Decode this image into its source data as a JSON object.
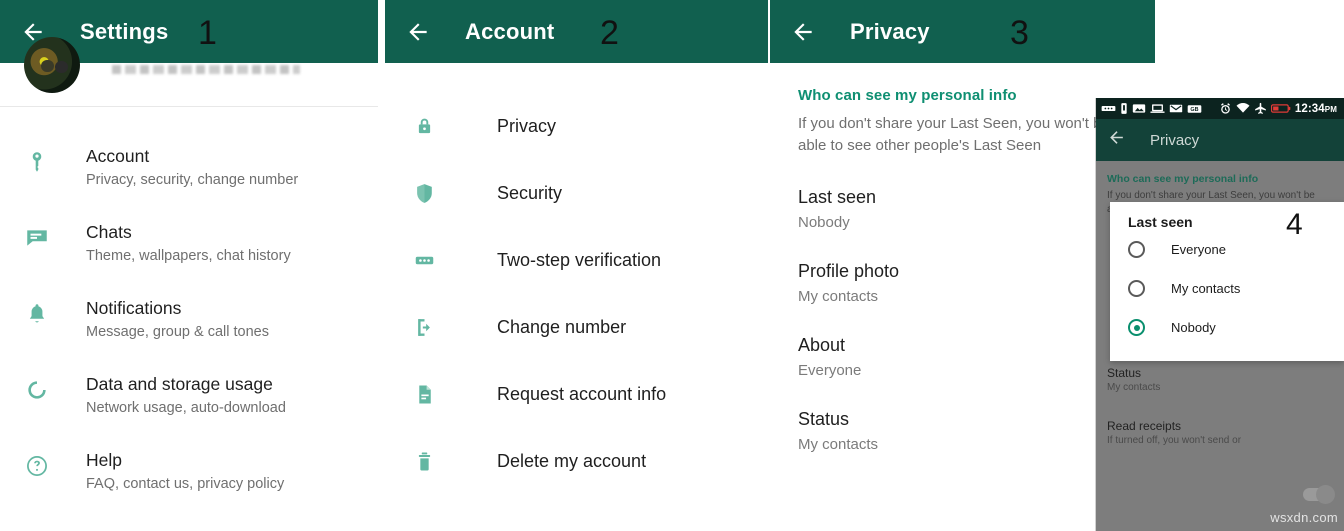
{
  "panels": {
    "settings": {
      "title": "Settings",
      "marker": "1",
      "back_icon": "back-arrow-icon",
      "items": [
        {
          "icon": "key-icon",
          "title": "Account",
          "subtitle": "Privacy, security, change number"
        },
        {
          "icon": "chat-icon",
          "title": "Chats",
          "subtitle": "Theme, wallpapers, chat history"
        },
        {
          "icon": "bell-icon",
          "title": "Notifications",
          "subtitle": "Message, group & call tones"
        },
        {
          "icon": "data-icon",
          "title": "Data and storage usage",
          "subtitle": "Network usage, auto-download"
        },
        {
          "icon": "help-icon",
          "title": "Help",
          "subtitle": "FAQ, contact us, privacy policy"
        }
      ]
    },
    "account": {
      "title": "Account",
      "marker": "2",
      "back_icon": "back-arrow-icon",
      "items": [
        {
          "icon": "lock-icon",
          "label": "Privacy"
        },
        {
          "icon": "shield-icon",
          "label": "Security"
        },
        {
          "icon": "dots-icon",
          "label": "Two-step verification"
        },
        {
          "icon": "exit-icon",
          "label": "Change number"
        },
        {
          "icon": "document-icon",
          "label": "Request account info"
        },
        {
          "icon": "trash-icon",
          "label": "Delete my account"
        }
      ]
    },
    "privacy": {
      "title": "Privacy",
      "marker": "3",
      "back_icon": "back-arrow-icon",
      "section_header": "Who can see my personal info",
      "section_description": "If you don't share your Last Seen, you won't be able to see other people's Last Seen",
      "rows": [
        {
          "title": "Last seen",
          "value": "Nobody"
        },
        {
          "title": "Profile photo",
          "value": "My contacts"
        },
        {
          "title": "About",
          "value": "Everyone"
        },
        {
          "title": "Status",
          "value": "My contacts"
        }
      ]
    },
    "phone": {
      "marker": "4",
      "statusbar": {
        "icons": [
          "dots-icon",
          "sim-icon",
          "image-icon",
          "laptop-icon",
          "gmail-icon",
          "gb-keyboard-icon",
          "alarm-icon",
          "wifi-icon",
          "airplane-icon",
          "battery-low-icon"
        ],
        "time": "12:34",
        "meridiem": "PM"
      },
      "appbar": {
        "title": "Privacy",
        "back_icon": "back-arrow-icon"
      },
      "section_header": "Who can see my personal info",
      "section_description": "If you don't share your Last Seen, you won't be able to see other people's Last Seen",
      "dialog": {
        "title": "Last seen",
        "options": [
          {
            "label": "Everyone",
            "selected": false
          },
          {
            "label": "My contacts",
            "selected": false
          },
          {
            "label": "Nobody",
            "selected": true
          }
        ]
      },
      "behind_rows": [
        {
          "title": "Status",
          "value": "My contacts"
        }
      ],
      "read_receipts": {
        "title": "Read receipts",
        "description": "If turned off, you won't send or",
        "toggle_on": false
      }
    }
  },
  "watermark": "wsxdn.com",
  "colors": {
    "appbar_green": "#11604f",
    "accent_green": "#0f8f72",
    "icon_green": "#63b7a2",
    "radio_selected": "#0a8f6e"
  }
}
